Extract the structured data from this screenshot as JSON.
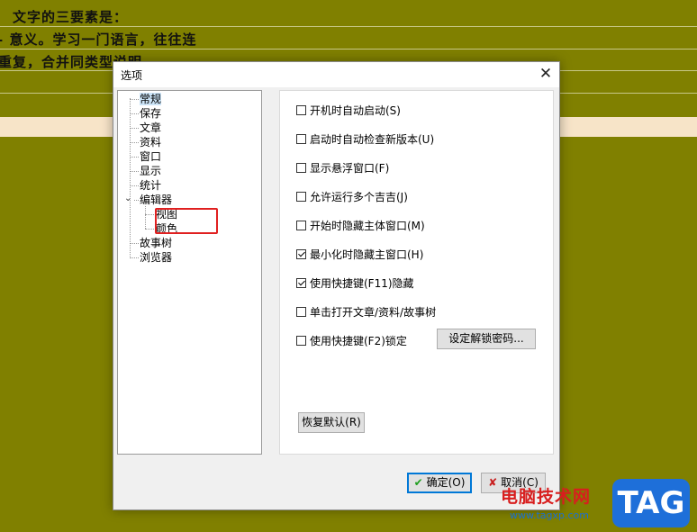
{
  "background": {
    "lines": [
      "文字的三要素是：",
      "- 意义。学习一门语言，往往连",
      "重复，合并同类型说明"
    ]
  },
  "dialog": {
    "title": "选项",
    "close_icon": "close-icon",
    "tree": {
      "items": [
        "常规",
        "保存",
        "文章",
        "资料",
        "窗口",
        "显示",
        "统计",
        "编辑器",
        "视图",
        "颜色",
        "故事树",
        "浏览器"
      ],
      "selected": "常规",
      "expander": "⌄"
    },
    "options": [
      {
        "label": "开机时自动启动(S)",
        "checked": false
      },
      {
        "label": "启动时自动检查新版本(U)",
        "checked": false
      },
      {
        "label": "显示悬浮窗口(F)",
        "checked": false
      },
      {
        "label": "允许运行多个吉吉(J)",
        "checked": false
      },
      {
        "label": "开始时隐藏主体窗口(M)",
        "checked": false
      },
      {
        "label": "最小化时隐藏主窗口(H)",
        "checked": true
      },
      {
        "label": "使用快捷键(F11)隐藏",
        "checked": true
      },
      {
        "label": "单击打开文章/资料/故事树",
        "checked": false
      },
      {
        "label": "使用快捷键(F2)锁定",
        "checked": false
      }
    ],
    "set_password_label": "设定解锁密码...",
    "restore_default_label": "恢复默认(R)",
    "ok_label": "确定(O)",
    "cancel_label": "取消(C)"
  },
  "watermark": {
    "site_name": "电脑技术网",
    "url": "www.tagxp.com",
    "tag": "TAG"
  }
}
